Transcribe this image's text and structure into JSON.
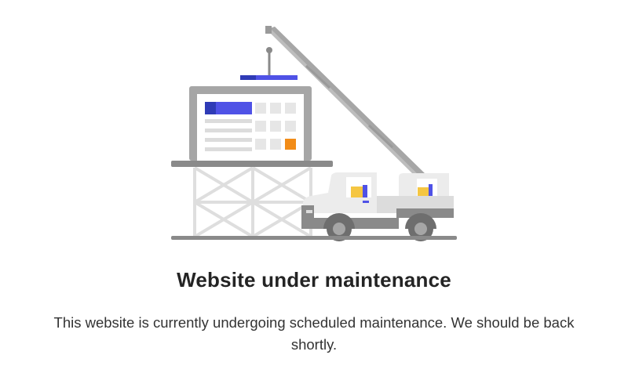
{
  "illustration": {
    "name": "maintenance-construction-illustration",
    "colors": {
      "gray_dark": "#8a8a8a",
      "gray_mid": "#a6a6a6",
      "gray_light": "#dcdcdc",
      "gray_lighter": "#ececec",
      "blue": "#4f52e6",
      "blue_dark": "#2f3bb6",
      "orange": "#f28c18",
      "yellow": "#f5c642",
      "white": "#ffffff"
    }
  },
  "heading": "Website under maintenance",
  "message": "This website is currently undergoing scheduled maintenance. We should be back shortly."
}
